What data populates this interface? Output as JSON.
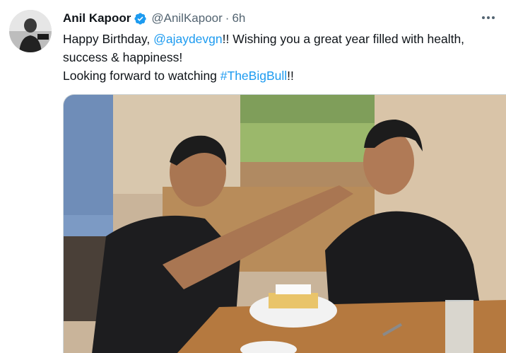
{
  "tweet": {
    "author_name": "Anil Kapoor",
    "handle": "@AnilKapoor",
    "separator": "·",
    "time": "6h",
    "text": {
      "line1_prefix": "Happy Birthday, ",
      "mention": "@ajaydevgn",
      "line1_suffix": "!! Wishing you a great year filled with health,",
      "line2": "success & happiness!",
      "line3_prefix": "Looking forward to watching ",
      "hashtag": "#TheBigBull",
      "line3_suffix": "!!"
    },
    "verified": true
  },
  "icons": {
    "verified": "verified-badge-icon",
    "more": "more-options-icon"
  },
  "colors": {
    "link": "#1d9bf0",
    "verified": "#1d9bf0",
    "secondary_text": "#536471"
  }
}
